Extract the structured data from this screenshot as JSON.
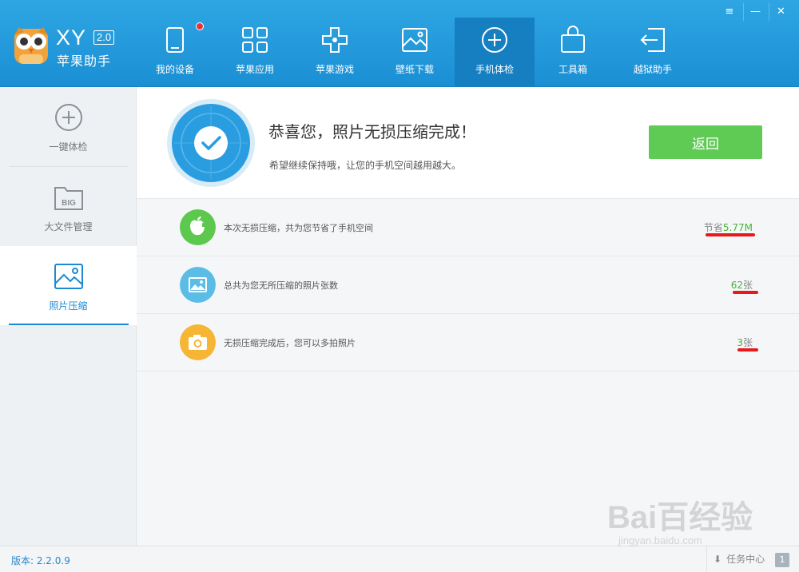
{
  "brand": {
    "name": "XY",
    "version_badge": "2.0",
    "subtitle": "苹果助手"
  },
  "nav": {
    "tabs": [
      {
        "label": "我的设备",
        "icon": "tablet-icon"
      },
      {
        "label": "苹果应用",
        "icon": "apps-grid-icon"
      },
      {
        "label": "苹果游戏",
        "icon": "gamepad-icon"
      },
      {
        "label": "壁纸下载",
        "icon": "wallpaper-icon"
      },
      {
        "label": "手机体检",
        "icon": "plus-circle-icon",
        "active": true
      },
      {
        "label": "工具箱",
        "icon": "toolbox-icon"
      },
      {
        "label": "越狱助手",
        "icon": "jailbreak-exit-icon"
      }
    ]
  },
  "window": {
    "menu": "≡",
    "minimize": "—",
    "close": "✕"
  },
  "sidebar": {
    "items": [
      {
        "label": "一键体检",
        "icon": "plus-circle-icon"
      },
      {
        "label": "大文件管理",
        "icon": "big-folder-icon",
        "icon_text": "BIG"
      },
      {
        "label": "照片压缩",
        "icon": "photo-icon",
        "active": true
      }
    ]
  },
  "hero": {
    "title": "恭喜您，照片无损压缩完成！",
    "subtitle": "希望继续保持哦，让您的手机空间越用越大。",
    "back_label": "返回"
  },
  "stats": [
    {
      "text": "本次无损压缩，共为您节省了手机空间",
      "prefix": "节省",
      "value": "5.77M",
      "suffix": "",
      "icon": "apple-icon",
      "color": "#5cc84d"
    },
    {
      "text": "总共为您无所压缩的照片张数",
      "prefix": "",
      "value": "62",
      "suffix": "张",
      "icon": "image-icon",
      "color": "#5bbde6"
    },
    {
      "text": "无损压缩完成后，您可以多拍照片",
      "prefix": "",
      "value": "3",
      "suffix": "张",
      "icon": "camera-icon",
      "color": "#f6b533"
    }
  ],
  "status": {
    "version": "版本: 2.2.0.9",
    "task_center": "任务中心",
    "task_count": "1"
  },
  "watermark": {
    "line1": "Bai百经验",
    "line2": "jingyan.baidu.com"
  },
  "colors": {
    "header": "#1f9ad9",
    "accent": "#1b8ad3",
    "green": "#5fcb55",
    "highlight": "#e8181b"
  }
}
